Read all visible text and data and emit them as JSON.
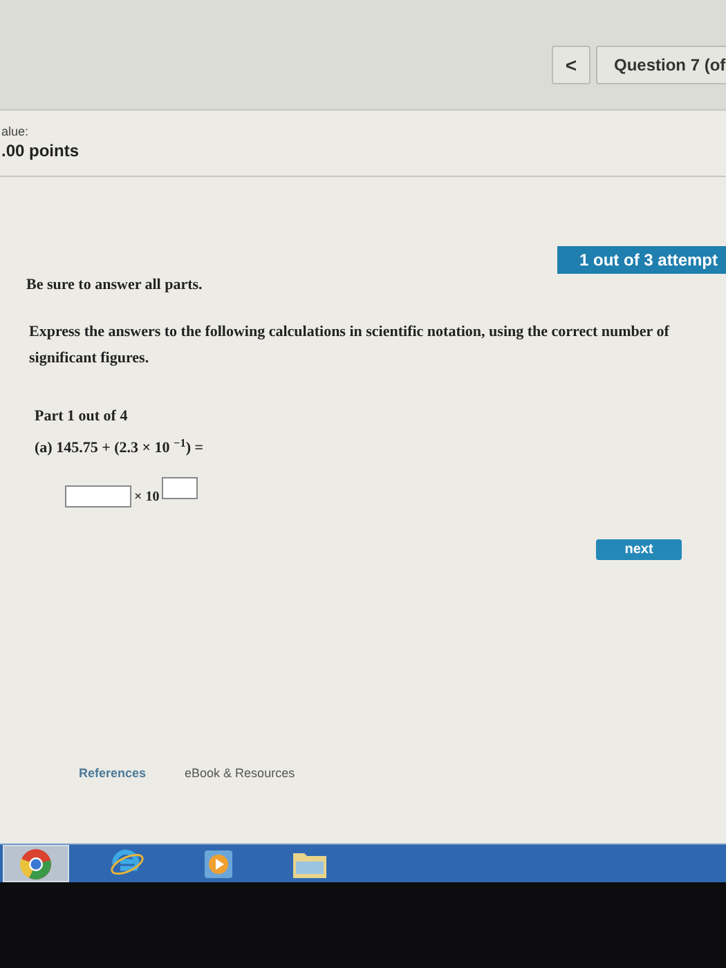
{
  "header": {
    "back_button": "<",
    "question_label": "Question 7 (of"
  },
  "points": {
    "label": "alue:",
    "value": ".00 points"
  },
  "attempts_badge": "1 out of 3 attempt",
  "instruction": "Be sure to answer all parts.",
  "prompt": "Express the answers to the following calculations in scientific notation, using the correct number of significant figures.",
  "part_label": "Part 1 out of 4",
  "question": "(a) 145.75 + (2.3 × 10 $^{−1}$) =",
  "answer": {
    "times_label": "× 10"
  },
  "next_button": "next",
  "links": [
    {
      "label": "References",
      "selected": true
    },
    {
      "label": "eBook & Resources",
      "selected": false
    }
  ],
  "taskbar": [
    {
      "kind": "browser",
      "selected": true
    },
    {
      "kind": "explorer",
      "selected": false
    },
    {
      "kind": "player",
      "selected": false
    },
    {
      "kind": "files",
      "selected": false
    }
  ]
}
